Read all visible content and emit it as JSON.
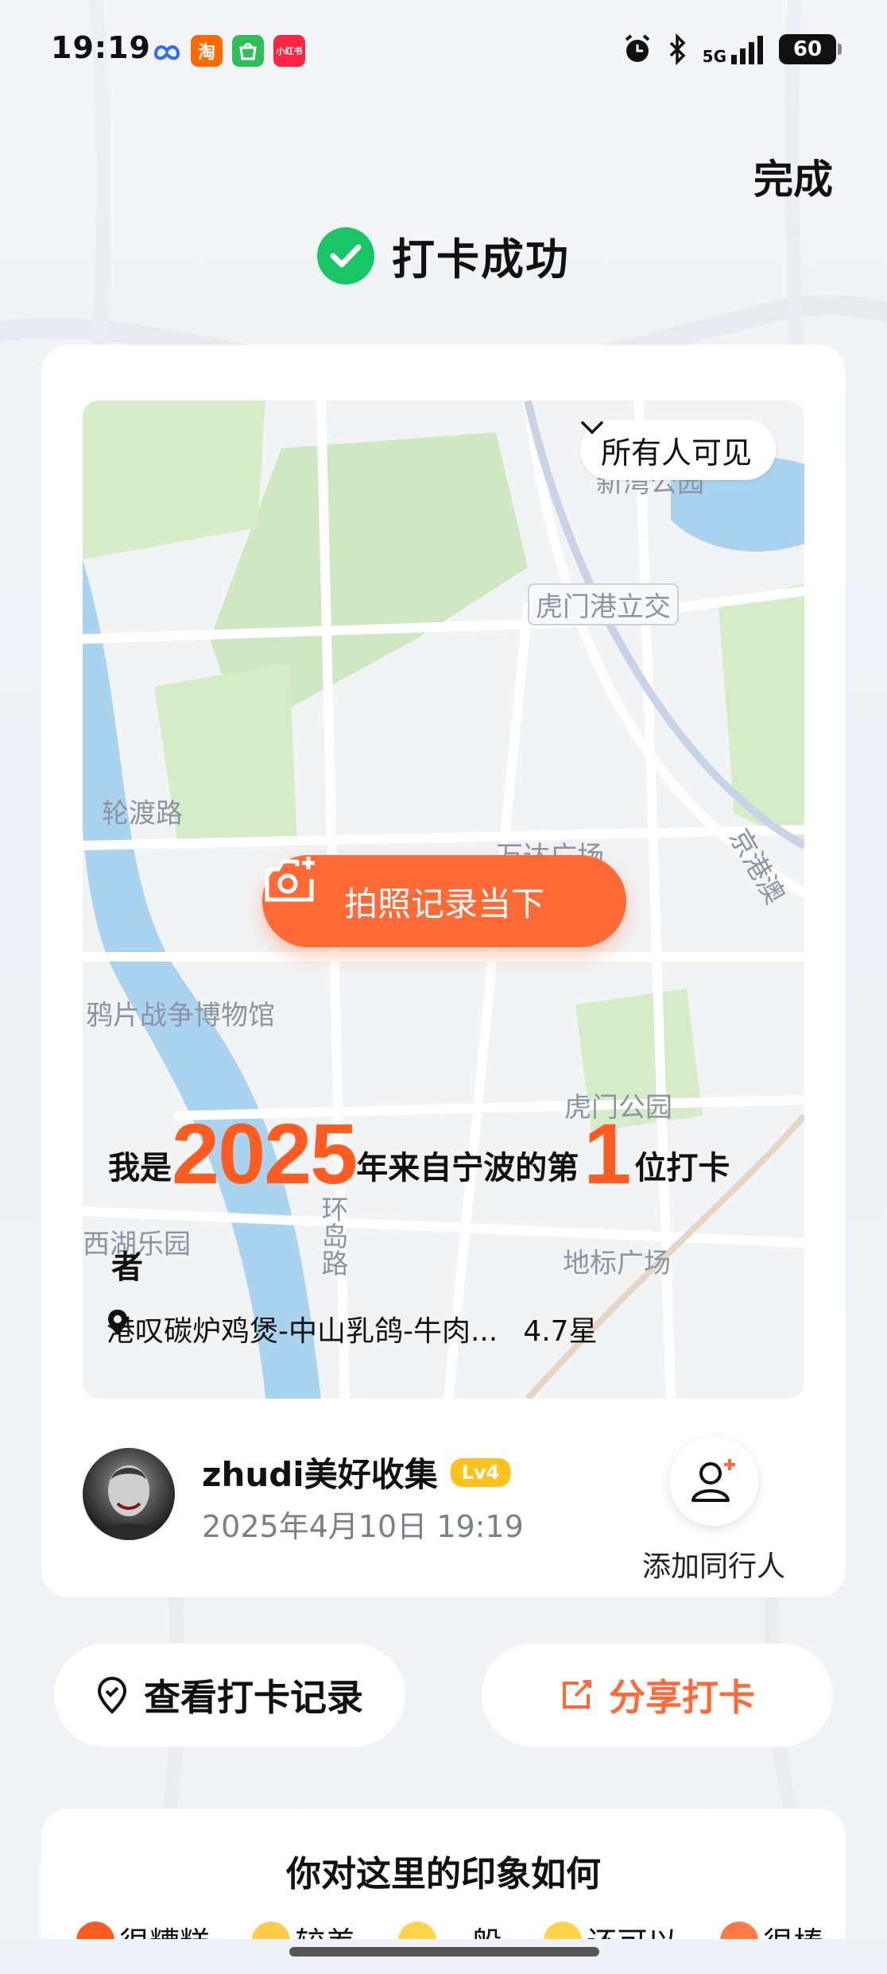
{
  "status_bar": {
    "time": "19:19",
    "network": "5G",
    "battery": "60",
    "apps": [
      "淘",
      "小红书"
    ]
  },
  "header": {
    "done_label": "完成",
    "success_title": "打卡成功"
  },
  "card": {
    "visibility_label": "所有人可见",
    "photo_button_label": "拍照记录当下",
    "map_labels": [
      "虎门港立交",
      "轮渡路",
      "万达广场",
      "京港澳",
      "鸦片战争博物馆",
      "虎门公园",
      "西湖乐园",
      "环岛路",
      "地标广场",
      "新湾公园"
    ],
    "checkin": {
      "prefix": "我是",
      "year": "2025",
      "middle": "年来自宁波的第",
      "rank": "1",
      "suffix": "位打卡",
      "tail": "者"
    },
    "poi": {
      "name": "港叹碳炉鸡煲-中山乳鸽-牛肉...",
      "rating": "4.7星"
    },
    "user": {
      "name": "zhudi美好收集",
      "level": "Lv4",
      "datetime": "2025年4月10日 19:19"
    },
    "add_companion_label": "添加同行人"
  },
  "actions": {
    "view_records_label": "查看打卡记录",
    "share_label": "分享打卡"
  },
  "impression": {
    "title": "你对这里的印象如何",
    "options": [
      {
        "label": "很糟糕",
        "color": "#ff5a1f"
      },
      {
        "label": "较差",
        "color": "#ffc94a"
      },
      {
        "label": "一般",
        "color": "#ffd24a"
      },
      {
        "label": "还可以",
        "color": "#ffd24a"
      },
      {
        "label": "很棒",
        "color": "#ff7a45"
      }
    ]
  },
  "colors": {
    "accent": "#ff6a36",
    "success": "#19c564",
    "level_badge": "#ffc21a"
  }
}
